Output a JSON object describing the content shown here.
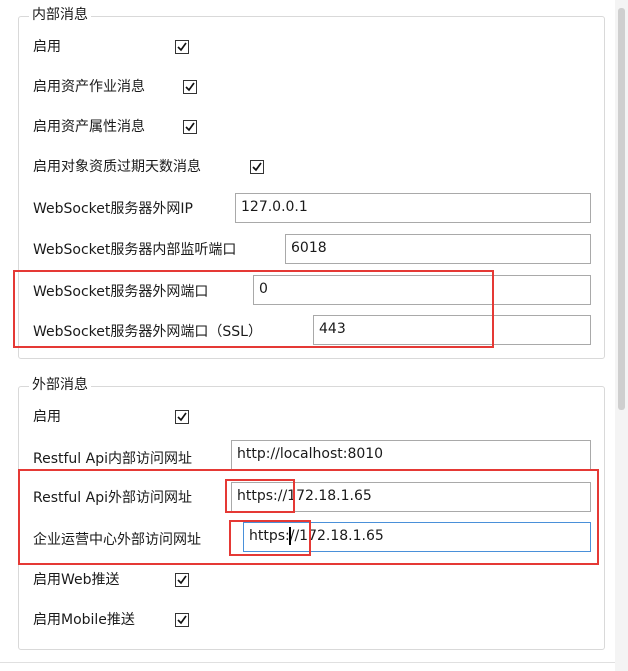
{
  "internal": {
    "legend": "内部消息",
    "enable_label": "启用",
    "enable_checked": true,
    "asset_job_label": "启用资产作业消息",
    "asset_job_checked": true,
    "asset_attr_label": "启用资产属性消息",
    "asset_attr_checked": true,
    "expire_days_label": "启用对象资质过期天数消息",
    "expire_days_checked": true,
    "ws_ip_label": "WebSocket服务器外网IP",
    "ws_ip_value": "127.0.0.1",
    "ws_internal_port_label": "WebSocket服务器内部监听端口",
    "ws_internal_port_value": "6018",
    "ws_external_port_label": "WebSocket服务器外网端口",
    "ws_external_port_value": "0",
    "ws_external_ssl_label": "WebSocket服务器外网端口（SSL）",
    "ws_external_ssl_value": "443"
  },
  "external": {
    "legend": "外部消息",
    "enable_label": "启用",
    "enable_checked": true,
    "restful_internal_label": "Restful Api内部访问网址",
    "restful_internal_value": "http://localhost:8010",
    "restful_external_label": "Restful Api外部访问网址",
    "restful_external_value": "https://172.18.1.65",
    "ops_center_label": "企业运营中心外部访问网址",
    "ops_center_value": "https://172.18.1.65",
    "web_push_label": "启用Web推送",
    "web_push_checked": true,
    "mobile_push_label": "启用Mobile推送",
    "mobile_push_checked": true
  },
  "icons": {
    "check": "checkmark-icon"
  },
  "colors": {
    "highlight": "#e53935",
    "focus_border": "#4a90d9",
    "group_border": "#d9d9d9"
  }
}
